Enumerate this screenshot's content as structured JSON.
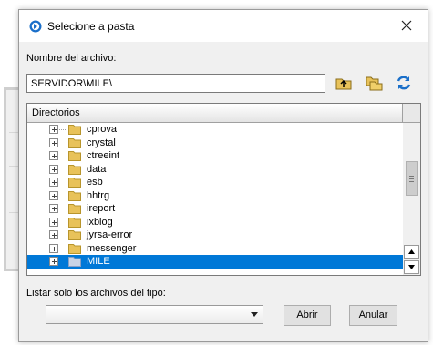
{
  "window": {
    "title": "Selecione a pasta"
  },
  "form": {
    "filename_label": "Nombre del archivo:",
    "path_value": "SERVIDOR\\MILE\\",
    "filter_label": "Listar solo los archivos del tipo:",
    "filter_value": ""
  },
  "tree": {
    "header": "Directorios",
    "items": [
      {
        "label": "cprova"
      },
      {
        "label": "crystal"
      },
      {
        "label": "ctreeint"
      },
      {
        "label": "data"
      },
      {
        "label": "esb"
      },
      {
        "label": "hhtrg"
      },
      {
        "label": "ireport"
      },
      {
        "label": "ixblog"
      },
      {
        "label": "jyrsa-error"
      },
      {
        "label": "messenger"
      },
      {
        "label": "MILE",
        "selected": true
      }
    ]
  },
  "buttons": {
    "open": "Abrir",
    "cancel": "Anular"
  },
  "colors": {
    "selection": "#0078d7",
    "folder": "#e8c25a"
  }
}
